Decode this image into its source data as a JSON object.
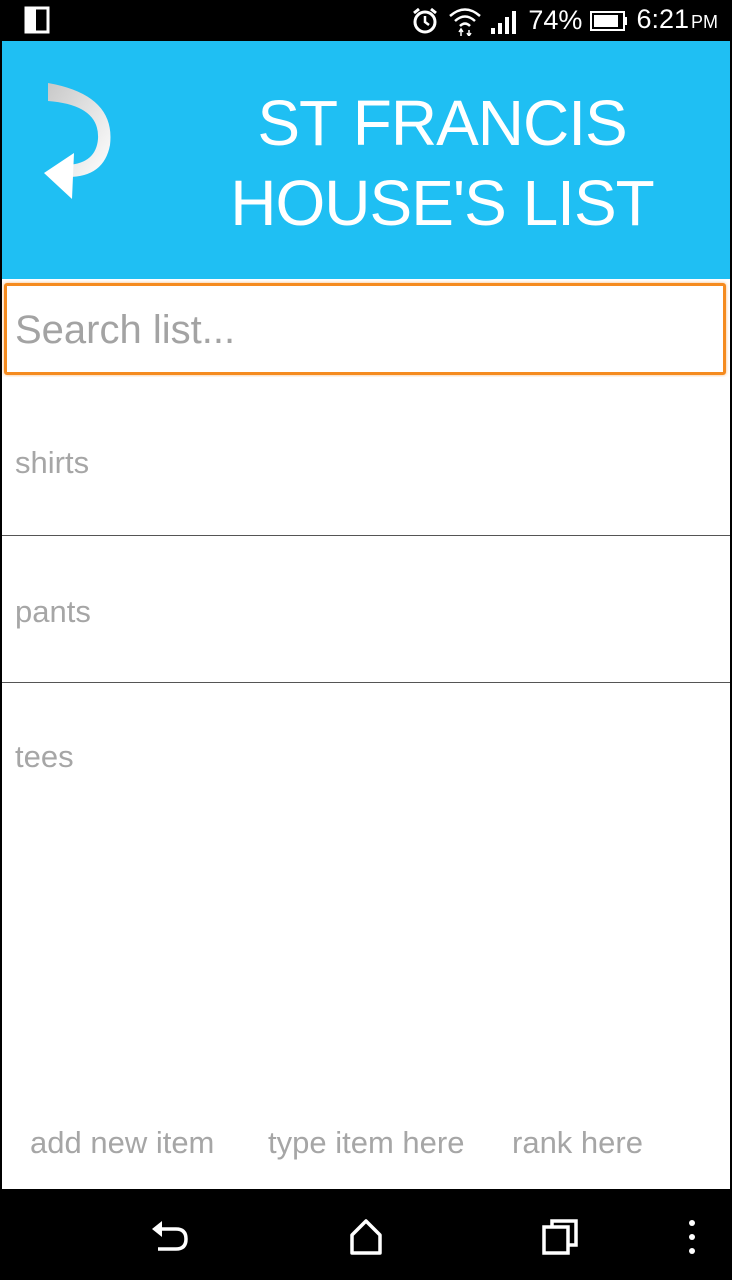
{
  "status_bar": {
    "battery": "74%",
    "time": "6:21",
    "ampm": "PM",
    "icons": [
      "phone-layout-icon",
      "alarm-icon",
      "wifi-icon",
      "signal-icon",
      "battery-icon"
    ]
  },
  "header": {
    "title_line1": "ST FRANCIS",
    "title_line2": "HOUSE'S LIST",
    "back_icon": "curved-back-arrow-icon",
    "background": "#1fbff3"
  },
  "search": {
    "placeholder": "Search list...",
    "value": "",
    "focus_color": "#f58b1f"
  },
  "list": {
    "items": [
      {
        "label": "shirts"
      },
      {
        "label": "pants"
      },
      {
        "label": "tees"
      }
    ]
  },
  "bottom_bar": {
    "add_label": "add new item",
    "item_placeholder": "type item here",
    "rank_placeholder": "rank here"
  },
  "nav_bar": {
    "icons": [
      "back-icon",
      "home-icon",
      "recents-icon",
      "overflow-menu-icon"
    ]
  }
}
